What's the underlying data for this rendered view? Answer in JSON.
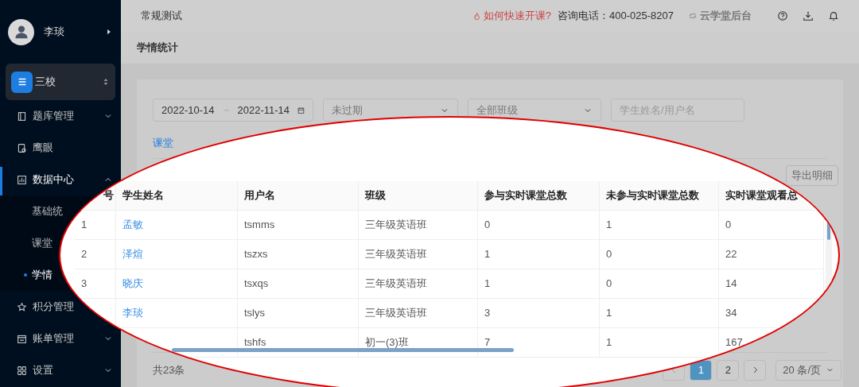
{
  "user": {
    "name": "李琰"
  },
  "school": {
    "name": "三校"
  },
  "sidebar": {
    "items": [
      {
        "label": "题库管理",
        "expanded": false,
        "selected": false
      },
      {
        "label": "鹰眼",
        "selected": false
      },
      {
        "label": "数据中心",
        "expanded": true,
        "selected": true,
        "children": [
          {
            "label": "基础统",
            "selected": false
          },
          {
            "label": "课堂",
            "selected": false
          },
          {
            "label": "学情",
            "selected": true
          }
        ]
      },
      {
        "label": "积分管理",
        "selected": false
      },
      {
        "label": "账单管理",
        "expanded": false,
        "selected": false
      },
      {
        "label": "设置",
        "expanded": false,
        "selected": false
      }
    ]
  },
  "top_bar": {
    "title": "常规测试",
    "help_link": "如何快速开课?",
    "phone": "咨询电话：400-025-8207",
    "backend_link": "云学堂后台"
  },
  "breadcrumb": "学情统计",
  "filters": {
    "date_start": "2022-10-14",
    "date_end": "2022-11-14",
    "status": "未过期",
    "class": "全部班级",
    "search": {
      "placeholder": "学生姓名/用户名"
    }
  },
  "tabs": [
    {
      "label": "课堂",
      "selected": true
    }
  ],
  "export_button": "导出明细",
  "table": {
    "columns": [
      "号",
      "学生姓名",
      "用户名",
      "班级",
      "参与实时课堂总数",
      "未参与实时课堂总数",
      "实时课堂观看总"
    ],
    "rows": [
      {
        "index": "1",
        "name": "孟敏",
        "username": "tsmms",
        "class": "三年级英语班",
        "joined": "0",
        "missed": "1",
        "minutes": "0"
      },
      {
        "index": "2",
        "name": "泽煊",
        "username": "tszxs",
        "class": "三年级英语班",
        "joined": "1",
        "missed": "0",
        "minutes": "22"
      },
      {
        "index": "3",
        "name": "晓庆",
        "username": "tsxqs",
        "class": "三年级英语班",
        "joined": "1",
        "missed": "0",
        "minutes": "14"
      },
      {
        "name": "李琰",
        "username": "tslys",
        "class": "三年级英语班",
        "joined": "3",
        "missed": "1",
        "minutes": "34"
      },
      {
        "username": "tshfs",
        "class": "初一(3)班",
        "joined": "7",
        "missed": "1",
        "minutes": "167"
      }
    ]
  },
  "footer": {
    "total": "共23条",
    "pages": [
      {
        "label": "1",
        "selected": true
      },
      {
        "label": "2",
        "selected": false
      }
    ],
    "page_size": "20 条/页"
  }
}
